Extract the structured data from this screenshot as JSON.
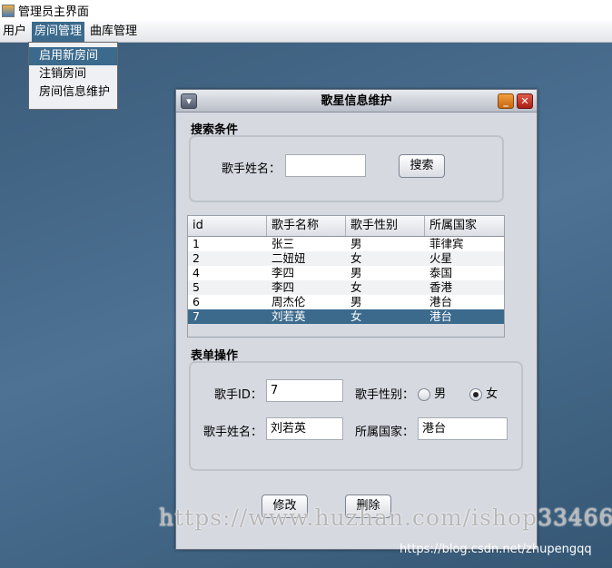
{
  "window": {
    "title": "管理员主界面"
  },
  "menubar": {
    "items": [
      "用户",
      "房间管理",
      "曲库管理"
    ]
  },
  "dropdown": {
    "items": [
      "启用新房间",
      "注销房间",
      "房间信息维护"
    ]
  },
  "dialog": {
    "title": "歌星信息维护",
    "search": {
      "group_label": "搜索条件",
      "name_label": "歌手姓名：",
      "name_value": "",
      "search_button": "搜索"
    },
    "table": {
      "columns": [
        "id",
        "歌手名称",
        "歌手性别",
        "所属国家"
      ],
      "rows": [
        [
          "1",
          "张三",
          "男",
          "菲律宾"
        ],
        [
          "2",
          "二妞妞",
          "女",
          "火星"
        ],
        [
          "4",
          "李四",
          "男",
          "泰国"
        ],
        [
          "5",
          "李四",
          "女",
          "香港"
        ],
        [
          "6",
          "周杰伦",
          "男",
          "港台"
        ],
        [
          "7",
          "刘若英",
          "女",
          "港台"
        ]
      ],
      "selected_row": 5
    },
    "form": {
      "group_label": "表单操作",
      "id_label": "歌手ID：",
      "id_value": "7",
      "gender_label": "歌手性别：",
      "male": "男",
      "female": "女",
      "gender_selected": "女",
      "name_label": "歌手姓名：",
      "name_value": "刘若英",
      "country_label": "所属国家：",
      "country_value": "港台"
    },
    "buttons": {
      "modify": "修改",
      "delete": "删除"
    }
  },
  "watermarks": {
    "huzhan": "https://www.huzhan.com/ishop33466",
    "csdn": "https://blog.csdn.net/zhupengqq"
  }
}
